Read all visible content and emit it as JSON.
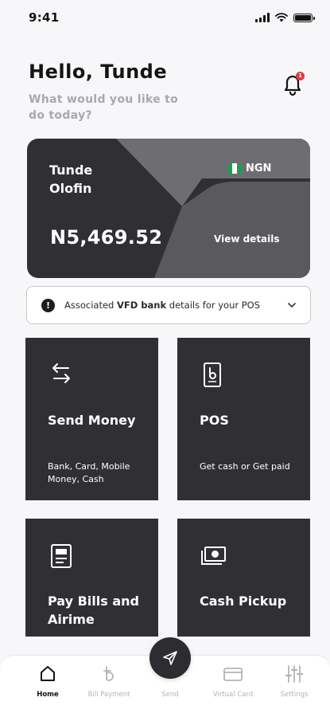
{
  "status_bar": {
    "time": "9:41"
  },
  "greeting": {
    "title": "Hello, Tunde",
    "subtitle": "What would you like to do today?",
    "notification_count": "1"
  },
  "account_card": {
    "holder_name": "Tunde Olofin",
    "currency": "NGN",
    "balance": "N5,469.52",
    "view_details": "View details"
  },
  "bank_details": {
    "prefix": "Associated ",
    "bank": "VFD bank",
    "suffix": " details for your POS"
  },
  "tiles": [
    {
      "title": "Send Money",
      "subtitle": "Bank, Card, Mobile Money, Cash",
      "icon": "arrows-exchange-icon"
    },
    {
      "title": "POS",
      "subtitle": "Get cash or Get paid",
      "icon": "pos-terminal-icon"
    },
    {
      "title": "Pay Bills and Airime",
      "subtitle": "",
      "icon": "bill-receipt-icon"
    },
    {
      "title": "Cash Pickup",
      "subtitle": "",
      "icon": "cash-icon"
    }
  ],
  "bottom_nav": [
    {
      "label": "Home",
      "icon": "home-icon",
      "active": true
    },
    {
      "label": "Bill Payment",
      "icon": "bill-payment-icon",
      "active": false
    },
    {
      "label": "Send",
      "icon": "send-icon",
      "active": false
    },
    {
      "label": "Virtual Card",
      "icon": "card-icon",
      "active": false
    },
    {
      "label": "Settings",
      "icon": "sliders-icon",
      "active": false
    }
  ],
  "colors": {
    "card_dark": "#303034",
    "card_mid": "#5a5a5e",
    "card_light": "#6e6e72",
    "tile_bg": "#303034",
    "page_bg": "#f7f7f9",
    "accent_red": "#e23a3a",
    "muted_text": "#a9a9ad"
  }
}
